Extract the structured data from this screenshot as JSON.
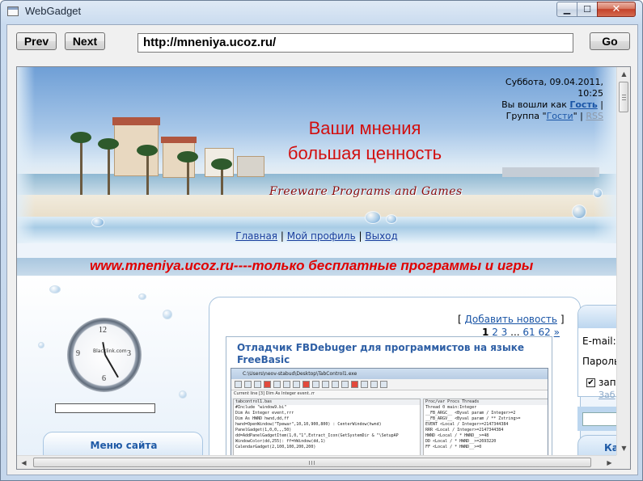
{
  "window": {
    "title": "WebGadget",
    "icons": {
      "app": "app-window-icon",
      "minimize": "minimize-icon",
      "maximize": "maximize-icon",
      "close": "close-icon"
    },
    "minimize_glyph": "▁",
    "maximize_glyph": "☐",
    "close_glyph": "✕"
  },
  "toolbar": {
    "prev_label": "Prev",
    "next_label": "Next",
    "url": "http://mneniya.ucoz.ru/",
    "go_label": "Go"
  },
  "site": {
    "date_line1": "Суббота, 09.04.2011,",
    "date_line2": "10:25",
    "logged_prefix": "Вы вошли как",
    "guest_link": "Гость",
    "group_prefix": "Группа \"",
    "group_link": "Гости",
    "group_suffix": "\"",
    "rss_link": "RSS",
    "sep": "|",
    "slogan_line1": "Ваши мнения",
    "slogan_line2": "большая ценность",
    "freeware_text": "Freeware Programs and Games",
    "nav": {
      "home": "Главная",
      "profile": "Мой профиль",
      "logout": "Выход"
    },
    "stripe_text": "www.mneniya.ucoz.ru----только бесплатные программы и игры",
    "clock_brand": "Blacklink.com",
    "clock_numbers": {
      "n12": "12",
      "n3": "3",
      "n6": "6",
      "n9": "9"
    },
    "menu_title": "Меню сайта",
    "add_news_open": "[",
    "add_news_link": "Добавить новость",
    "add_news_close": "]",
    "pager": {
      "current": "1",
      "p2": "2",
      "p3": "3",
      "ellipsis": "...",
      "p61": "61",
      "p62": "62",
      "next": "»"
    },
    "article_title": "Отладчик FBDebuger для программистов на языке FreeBasic",
    "screenshot": {
      "title": "C:\\Users\\neov-stabud\\Desktop\\TabControl1.exe",
      "bar_text": "Current line  [3] Dim As Integer event..rr",
      "tab_left": "tabcontrol1.bas",
      "tabs_right": "Proc/var   Procs   Threads",
      "code": [
        "#Include \"window9.bi\"",
        "Dim As Integer event,rrr",
        "Dim As HWND hwnd,dd,ff",
        "hwnd=OpenWindow(\"Tpewar\",10,10,900,800) : CenterWindow(hwnd)",
        "PanelGadget(1,0,0,,,50)",
        "",
        "dd=AddPanelGadgetItem(1,0,\"1\",Extract_Icon(GetSystemDir & \"\\SetupAP",
        "WindowColor(dd,255): ff=hWindow(dd,1)",
        "CalendarGadget(2,100,100,200,200)"
      ],
      "vars": [
        "Thread 0 main:Integer",
        "  __FB_ARGC__ <Byval param / Integer>=2",
        "  __FB_ARGV__ <Byval param / ** Zstring>=",
        "  EVENT <Local / Integer>=2147344384",
        "  RRR <Local / Integer>=2147344384",
        "  HWND <Local / * HWND__>=48",
        "  DD <Local / * HWND__>=2693220",
        "  FF <Local / * HWND__>=0"
      ]
    },
    "login": {
      "email_label": "E-mail:",
      "password_label": "Пароль",
      "remember_label": "зап",
      "forgot_label": "Заб",
      "check_glyph": "✔"
    },
    "catalog_title": "Ка"
  },
  "scrollbars": {
    "up_glyph": "▲",
    "down_glyph": "▼",
    "left_glyph": "◀",
    "right_glyph": "▶"
  }
}
